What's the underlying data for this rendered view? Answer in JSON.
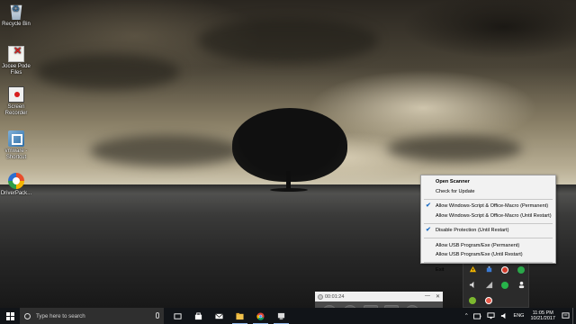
{
  "desktop": {
    "icons": [
      {
        "label": "Recycle Bin",
        "icon": "recycle-bin-icon"
      },
      {
        "label": "Jocee Pode Files",
        "icon": "file-icon"
      },
      {
        "label": "Screen Recorder",
        "icon": "screen-recorder-icon"
      },
      {
        "label": "vmware - Shortcut",
        "icon": "vmware-icon"
      },
      {
        "label": "DriverPack...",
        "icon": "driverpack-icon"
      }
    ]
  },
  "context_menu": {
    "groups": [
      [
        {
          "label": "Open Scanner",
          "bold": true,
          "checked": false
        },
        {
          "label": "Check for Update",
          "bold": false,
          "checked": false
        }
      ],
      [
        {
          "label": "Allow Windows-Script & Office-Macro (Permanent)",
          "bold": false,
          "checked": true
        },
        {
          "label": "Allow Windows-Script & Office-Macro (Until Restart)",
          "bold": false,
          "checked": false
        }
      ],
      [
        {
          "label": "Disable Protection (Until Restart)",
          "bold": false,
          "checked": true
        }
      ],
      [
        {
          "label": "Allow USB Program/Exe (Permanent)",
          "bold": false,
          "checked": false
        },
        {
          "label": "Allow USB Program/Exe (Until Restart)",
          "bold": false,
          "checked": false
        }
      ],
      [
        {
          "label": "Exit",
          "bold": false,
          "checked": false
        }
      ]
    ]
  },
  "tray_overflow": {
    "icons": [
      "warning-shield-icon",
      "network-icon",
      "red-record-icon",
      "green-app-icon",
      "speaker-icon",
      "wifi-icon",
      "green-check-icon",
      "user-icon",
      "shield-app-icon",
      "red-circle-icon"
    ]
  },
  "recorder": {
    "time": "00:01:24",
    "minimize": "—",
    "close": "✕"
  },
  "taskbar": {
    "search_placeholder": "Type here to search",
    "apps": [
      "task-view-icon",
      "store-icon",
      "mail-icon",
      "file-explorer-icon",
      "chrome-icon",
      "app-icon"
    ],
    "tray": {
      "chevron": "^",
      "language": "ENG",
      "time": "11:05 PM",
      "date": "10/21/2017"
    }
  },
  "colors": {
    "menu_bg": "#f2f2f2",
    "check": "#1f6fc4",
    "taskbar": "#111418",
    "search_box": "#2f2f2f"
  }
}
